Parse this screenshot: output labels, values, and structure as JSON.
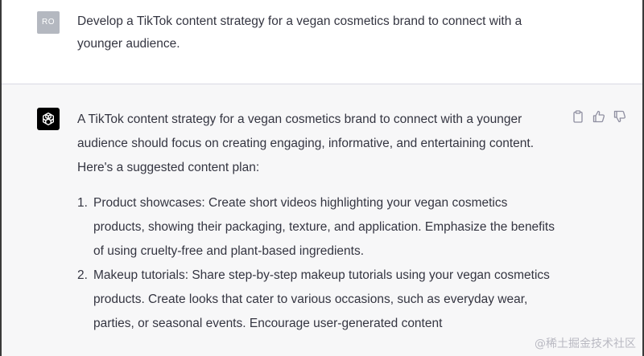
{
  "user_message": {
    "avatar_initials": "RO",
    "text": "Develop a TikTok content strategy for a vegan cosmetics brand to connect with a younger audience."
  },
  "assistant_message": {
    "avatar_icon": "openai-logo-icon",
    "intro": "A TikTok content strategy for a vegan cosmetics brand to connect with a younger audience should focus on creating engaging, informative, and entertaining content. Here's a suggested content plan:",
    "items": [
      {
        "number": "1.",
        "text": "Product showcases: Create short videos highlighting your vegan cosmetics products, showing their packaging, texture, and application. Emphasize the benefits of using cruelty-free and plant-based ingredients."
      },
      {
        "number": "2.",
        "text": "Makeup tutorials: Share step-by-step makeup tutorials using your vegan cosmetics products. Create looks that cater to various occasions, such as everyday wear, parties, or seasonal events. Encourage user-generated content"
      }
    ],
    "actions": [
      {
        "icon": "copy-icon"
      },
      {
        "icon": "thumbs-up-icon"
      },
      {
        "icon": "thumbs-down-icon"
      }
    ]
  },
  "watermark": "@稀土掘金技术社区",
  "colors": {
    "text": "#343541",
    "assistant_bg": "#f7f7f8",
    "user_avatar_bg": "#b4b8c0",
    "icon": "#8e8ea0"
  }
}
